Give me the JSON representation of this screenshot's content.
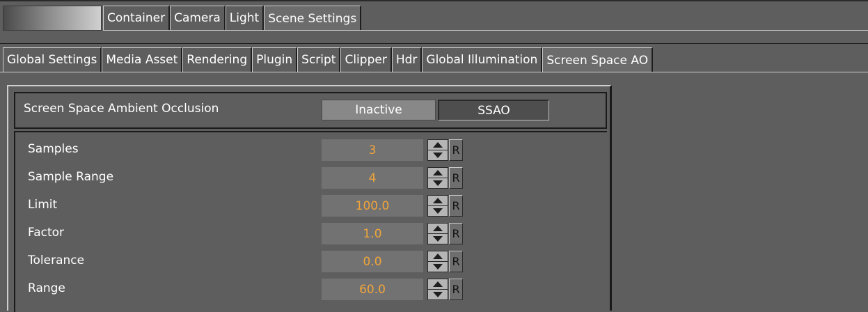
{
  "object_tabs": [
    {
      "label": "Container",
      "active": false
    },
    {
      "label": "Camera",
      "active": false
    },
    {
      "label": "Light",
      "active": false
    },
    {
      "label": "Scene Settings",
      "active": true
    }
  ],
  "settings_tabs": [
    {
      "label": "Global Settings",
      "active": false
    },
    {
      "label": "Media Asset",
      "active": false
    },
    {
      "label": "Rendering",
      "active": false
    },
    {
      "label": "Plugin",
      "active": false
    },
    {
      "label": "Script",
      "active": false
    },
    {
      "label": "Clipper",
      "active": false
    },
    {
      "label": "Hdr",
      "active": false
    },
    {
      "label": "Global Illumination",
      "active": false
    },
    {
      "label": "Screen Space AO",
      "active": true
    }
  ],
  "ssao": {
    "header_label": "Screen Space Ambient Occlusion",
    "mode_options": [
      "Inactive",
      "SSAO"
    ],
    "mode_selected": "SSAO",
    "params": [
      {
        "label": "Samples",
        "value": "3"
      },
      {
        "label": "Sample Range",
        "value": "4"
      },
      {
        "label": "Limit",
        "value": "100.0"
      },
      {
        "label": "Factor",
        "value": "1.0"
      },
      {
        "label": "Tolerance",
        "value": "0.0"
      },
      {
        "label": "Range",
        "value": "60.0"
      }
    ],
    "reset_label": "R"
  },
  "colors": {
    "background": "#5e5e5e",
    "value_text": "#f0a53a",
    "value_field": "#727272"
  }
}
